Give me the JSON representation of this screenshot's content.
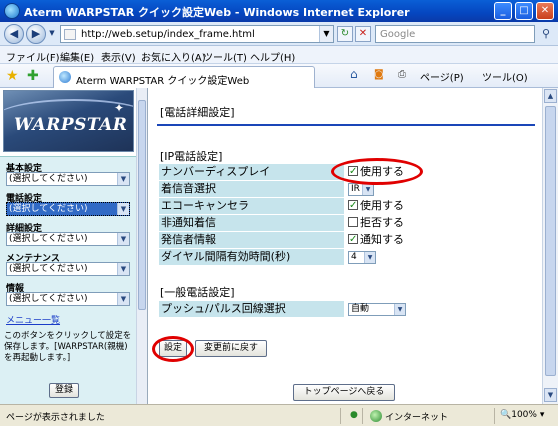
{
  "window": {
    "title": "Aterm WARPSTAR クイック設定Web - Windows Internet Explorer",
    "minimize": "_",
    "maximize": "□",
    "close": "✕"
  },
  "address": {
    "url": "http://web.setup/index_frame.html",
    "search_placeholder": "Google"
  },
  "menu": [
    "ファイル(F)",
    "編集(E)",
    "表示(V)",
    "お気に入り(A)",
    "ツール(T)",
    "ヘルプ(H)"
  ],
  "tab": {
    "label": "Aterm WARPSTAR クイック設定Web"
  },
  "toolbar": {
    "page": "ページ(P)",
    "tools": "ツール(O)"
  },
  "left": {
    "logo_text": "WARPSTAR",
    "groups": [
      {
        "label": "基本設定",
        "value": "(選択してください)"
      },
      {
        "label": "電話設定",
        "value": "(選択してください)"
      },
      {
        "label": "詳細設定",
        "value": "(選択してください)"
      },
      {
        "label": "メンテナンス",
        "value": "(選択してください)"
      },
      {
        "label": "情報",
        "value": "(選択してください)"
      }
    ],
    "menu_link": "メニュー一覧",
    "help_text": "このボタンをクリックして設定を保存します。[WARPSTAR(親機)を再起動します。]",
    "register_button": "登録"
  },
  "main": {
    "page_title": "[電話詳細設定]",
    "ip_section_title": "[IP電話設定]",
    "ip_rows": [
      {
        "label": "ナンバーディスプレイ",
        "checkbox": true,
        "value": "使用する"
      },
      {
        "label": "着信音選択",
        "select": "IR"
      },
      {
        "label": "エコーキャンセラ",
        "checkbox": true,
        "value": "使用する"
      },
      {
        "label": "非通知着信",
        "checkbox": false,
        "value": "拒否する"
      },
      {
        "label": "発信者情報",
        "checkbox": true,
        "value": "通知する"
      },
      {
        "label": "ダイヤル間隔有効時間(秒)",
        "select": "4"
      }
    ],
    "general_section_title": "[一般電話設定]",
    "general_rows": [
      {
        "label": "プッシュ/パルス回線選択",
        "select": "自動"
      }
    ],
    "set_button": "設定",
    "revert_button": "変更前に戻す",
    "top_button": "トップページへ戻る"
  },
  "status": {
    "text": "ページが表示されました",
    "zone": "インターネット",
    "zoom": "100%"
  },
  "colors": {
    "title_bar": "#0a5fd6",
    "label_bg": "#c6e4ec",
    "left_panel": "#dcf0f4",
    "heading_line": "#1a46b8",
    "annotation": "#e00000"
  }
}
